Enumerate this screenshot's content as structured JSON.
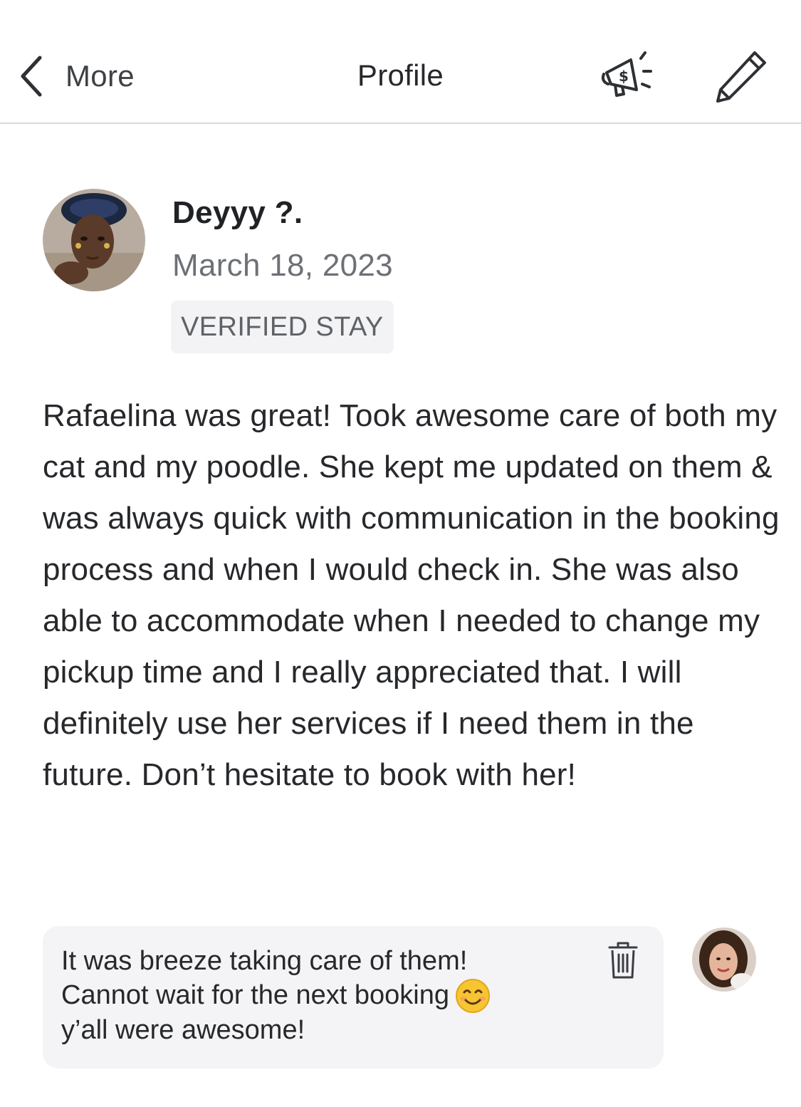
{
  "header": {
    "back_label": "More",
    "title": "Profile"
  },
  "review": {
    "reviewer_name": "Deyyy ?.",
    "date": "March 18, 2023",
    "badge": "VERIFIED STAY",
    "text": "Rafaelina was great! Took awesome care of both my cat and my poodle. She kept me updated on them & was always quick with communication in the booking process and when I would check in. She was also able to accommodate when I needed to change my pickup time and I really appreciated that. I will definitely use her services if I need them in the future. Don’t hesitate to book with her!"
  },
  "reply": {
    "text": "It was breeze taking care of them!\nCannot wait for the next booking",
    "text_end": "y’all were awesome!",
    "emoji": "smiling-face-emoji"
  },
  "icons": {
    "back": "chevron-left-icon",
    "promo": "megaphone-dollar-icon",
    "edit": "pencil-icon",
    "delete": "trash-icon"
  }
}
